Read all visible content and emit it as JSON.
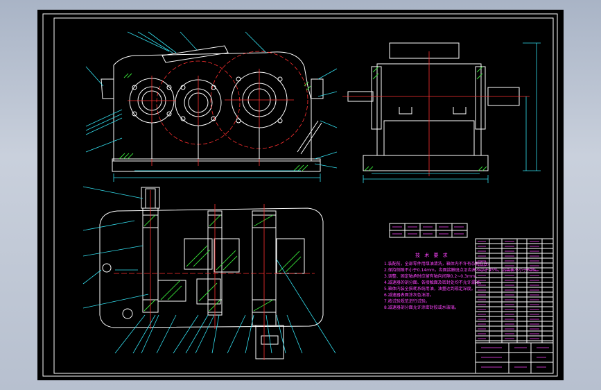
{
  "colors": {
    "background": "#000000",
    "outline": "#ffffff",
    "dimension": "#33e0f0",
    "centerline": "#ff3030",
    "hatch": "#37e037",
    "text": "#ff44ff",
    "window": "#b7c0cf"
  },
  "technical_requirements": {
    "title": "技 术 要 求",
    "items": [
      "1.装配前，全部零件用煤油清洗，箱体内不许有杂物存在。",
      "2.保持侧隙不小于0.14mm，齿面接触斑点沿齿高不小于45%，沿齿长不小于60%。",
      "3.调整、固定轴承时应留有轴向间隙0.2~0.3mm。",
      "4.减速器的剖分面、各接触面及密封处均不允许漏油。",
      "5.箱体内装全损耗系统用油，油量达到规定深度。",
      "6.减速器表面涂灰色油漆。",
      "7.按试验规范进行试验。",
      "8.减速器剖分面允许涂密封胶或水玻璃。"
    ]
  },
  "icons": [
    "drawing-frame-icon",
    "gear-circle-icon",
    "bearing-icon"
  ]
}
